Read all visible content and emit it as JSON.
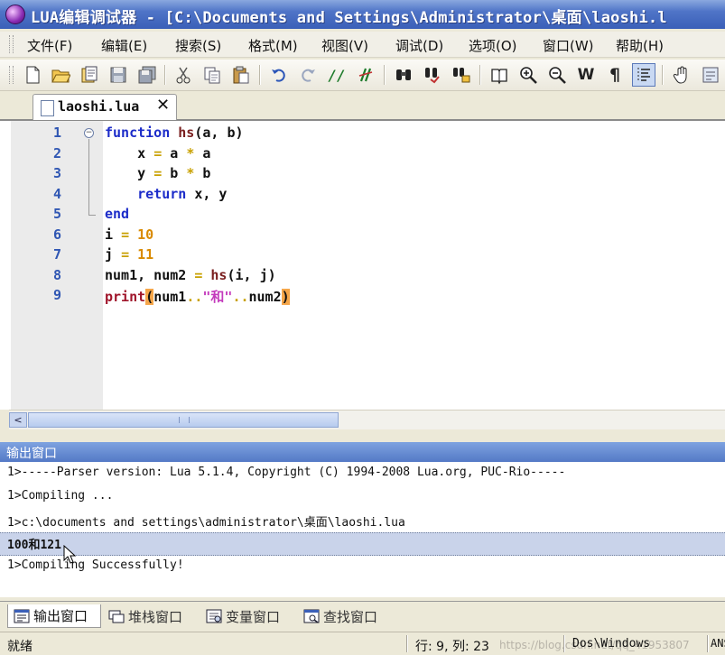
{
  "window": {
    "title": "LUA编辑调试器 - [C:\\Documents and Settings\\Administrator\\桌面\\laoshi.l"
  },
  "menu": [
    "文件(F)",
    "编辑(E)",
    "搜索(S)",
    "格式(M)",
    "视图(V)",
    "调试(D)",
    "选项(O)",
    "窗口(W)",
    "帮助(H)"
  ],
  "toolbar": {
    "icons": [
      "new-file-icon",
      "open-folder-icon",
      "open-project-icon",
      "save-icon",
      "save-all-icon",
      "cut-icon",
      "copy-icon",
      "paste-icon",
      "undo-icon",
      "redo-icon",
      "comment-icon",
      "uncomment-icon",
      "find-icon",
      "find-next-icon",
      "replace-icon",
      "bookmark-icon",
      "zoom-in-icon",
      "zoom-out-icon",
      "word-wrap-icon",
      "pilcrow-icon",
      "indent-guide-icon",
      "hand-icon",
      "more-icon"
    ],
    "comment_glyph": "//",
    "word_wrap_glyph": "W",
    "pilcrow_glyph": "¶"
  },
  "tab": {
    "label": "laoshi.lua",
    "close": "✕"
  },
  "editor": {
    "line_numbers": [
      "1",
      "2",
      "3",
      "4",
      "5",
      "6",
      "7",
      "8",
      "9"
    ],
    "fold_symbol": "−",
    "code": {
      "l1_kw": "function",
      "l1_fn": "hs",
      "l1_args": "(a, b)",
      "l2_a": "x",
      "l2_eq": "=",
      "l2_b": "a",
      "l2_op": "*",
      "l2_c": "a",
      "l3_a": "y",
      "l3_eq": "=",
      "l3_b": "b",
      "l3_op": "*",
      "l3_c": "b",
      "l4_kw": "return",
      "l4_rest": " x, y",
      "l5_kw": "end",
      "l6_var": "i",
      "l6_eq": "=",
      "l6_num": "10",
      "l7_var": "j",
      "l7_eq": "=",
      "l7_num": "11",
      "l8_lhs": "num1, num2",
      "l8_eq": "=",
      "l8_fn": "hs",
      "l8_args": "(i, j)",
      "l9_fn": "print",
      "l9_open": "(",
      "l9_v1": "num1",
      "l9_cat1": "..",
      "l9_str": "\"和\"",
      "l9_cat2": "..",
      "l9_v2": "num2",
      "l9_close": ")"
    }
  },
  "scrollbar": {
    "left_arrow": "<"
  },
  "output": {
    "title": "输出窗口",
    "lines": [
      "1>-----Parser version: Lua 5.1.4, Copyright (C) 1994-2008 Lua.org, PUC-Rio-----",
      "1>Compiling ...",
      "1>c:\\documents and settings\\administrator\\桌面\\laoshi.lua",
      "100和121",
      "1>Compiling Successfully!"
    ]
  },
  "bottom_tabs": [
    "输出窗口",
    "堆栈窗口",
    "变量窗口",
    "查找窗口"
  ],
  "status": {
    "ready": "就绪",
    "position": "行: 9,  列: 23",
    "line_ending": "Dos\\Windows",
    "encoding": "ANS",
    "watermark": "https://blog.csdn.net/qq_41953807"
  },
  "colors": {
    "keyword": "#1c2cc9",
    "line_number": "#2f56b3",
    "string": "#c43bbd",
    "number": "#d98a00",
    "brace_highlight": "#f5a64a",
    "output_header": "#5479c6"
  }
}
